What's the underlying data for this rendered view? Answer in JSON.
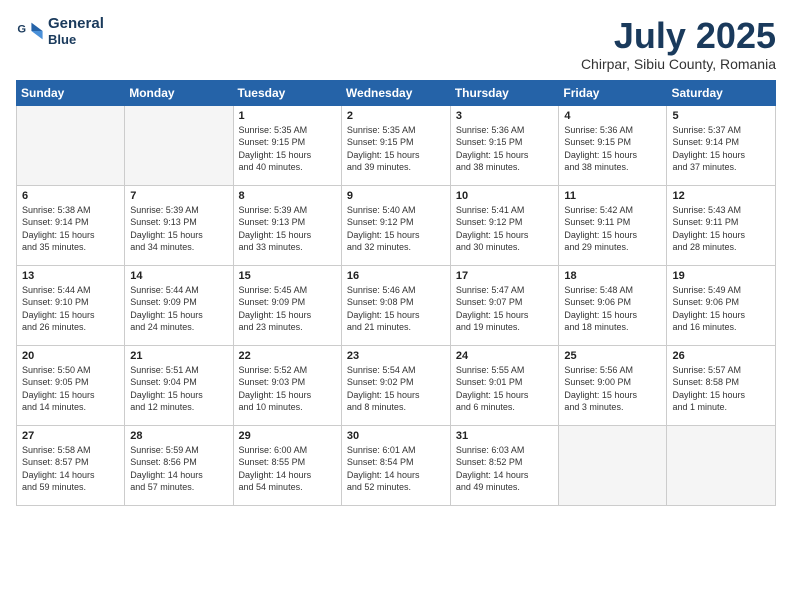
{
  "logo": {
    "line1": "General",
    "line2": "Blue"
  },
  "title": "July 2025",
  "subtitle": "Chirpar, Sibiu County, Romania",
  "weekdays": [
    "Sunday",
    "Monday",
    "Tuesday",
    "Wednesday",
    "Thursday",
    "Friday",
    "Saturday"
  ],
  "weeks": [
    [
      {
        "day": "",
        "info": ""
      },
      {
        "day": "",
        "info": ""
      },
      {
        "day": "1",
        "info": "Sunrise: 5:35 AM\nSunset: 9:15 PM\nDaylight: 15 hours\nand 40 minutes."
      },
      {
        "day": "2",
        "info": "Sunrise: 5:35 AM\nSunset: 9:15 PM\nDaylight: 15 hours\nand 39 minutes."
      },
      {
        "day": "3",
        "info": "Sunrise: 5:36 AM\nSunset: 9:15 PM\nDaylight: 15 hours\nand 38 minutes."
      },
      {
        "day": "4",
        "info": "Sunrise: 5:36 AM\nSunset: 9:15 PM\nDaylight: 15 hours\nand 38 minutes."
      },
      {
        "day": "5",
        "info": "Sunrise: 5:37 AM\nSunset: 9:14 PM\nDaylight: 15 hours\nand 37 minutes."
      }
    ],
    [
      {
        "day": "6",
        "info": "Sunrise: 5:38 AM\nSunset: 9:14 PM\nDaylight: 15 hours\nand 35 minutes."
      },
      {
        "day": "7",
        "info": "Sunrise: 5:39 AM\nSunset: 9:13 PM\nDaylight: 15 hours\nand 34 minutes."
      },
      {
        "day": "8",
        "info": "Sunrise: 5:39 AM\nSunset: 9:13 PM\nDaylight: 15 hours\nand 33 minutes."
      },
      {
        "day": "9",
        "info": "Sunrise: 5:40 AM\nSunset: 9:12 PM\nDaylight: 15 hours\nand 32 minutes."
      },
      {
        "day": "10",
        "info": "Sunrise: 5:41 AM\nSunset: 9:12 PM\nDaylight: 15 hours\nand 30 minutes."
      },
      {
        "day": "11",
        "info": "Sunrise: 5:42 AM\nSunset: 9:11 PM\nDaylight: 15 hours\nand 29 minutes."
      },
      {
        "day": "12",
        "info": "Sunrise: 5:43 AM\nSunset: 9:11 PM\nDaylight: 15 hours\nand 28 minutes."
      }
    ],
    [
      {
        "day": "13",
        "info": "Sunrise: 5:44 AM\nSunset: 9:10 PM\nDaylight: 15 hours\nand 26 minutes."
      },
      {
        "day": "14",
        "info": "Sunrise: 5:44 AM\nSunset: 9:09 PM\nDaylight: 15 hours\nand 24 minutes."
      },
      {
        "day": "15",
        "info": "Sunrise: 5:45 AM\nSunset: 9:09 PM\nDaylight: 15 hours\nand 23 minutes."
      },
      {
        "day": "16",
        "info": "Sunrise: 5:46 AM\nSunset: 9:08 PM\nDaylight: 15 hours\nand 21 minutes."
      },
      {
        "day": "17",
        "info": "Sunrise: 5:47 AM\nSunset: 9:07 PM\nDaylight: 15 hours\nand 19 minutes."
      },
      {
        "day": "18",
        "info": "Sunrise: 5:48 AM\nSunset: 9:06 PM\nDaylight: 15 hours\nand 18 minutes."
      },
      {
        "day": "19",
        "info": "Sunrise: 5:49 AM\nSunset: 9:06 PM\nDaylight: 15 hours\nand 16 minutes."
      }
    ],
    [
      {
        "day": "20",
        "info": "Sunrise: 5:50 AM\nSunset: 9:05 PM\nDaylight: 15 hours\nand 14 minutes."
      },
      {
        "day": "21",
        "info": "Sunrise: 5:51 AM\nSunset: 9:04 PM\nDaylight: 15 hours\nand 12 minutes."
      },
      {
        "day": "22",
        "info": "Sunrise: 5:52 AM\nSunset: 9:03 PM\nDaylight: 15 hours\nand 10 minutes."
      },
      {
        "day": "23",
        "info": "Sunrise: 5:54 AM\nSunset: 9:02 PM\nDaylight: 15 hours\nand 8 minutes."
      },
      {
        "day": "24",
        "info": "Sunrise: 5:55 AM\nSunset: 9:01 PM\nDaylight: 15 hours\nand 6 minutes."
      },
      {
        "day": "25",
        "info": "Sunrise: 5:56 AM\nSunset: 9:00 PM\nDaylight: 15 hours\nand 3 minutes."
      },
      {
        "day": "26",
        "info": "Sunrise: 5:57 AM\nSunset: 8:58 PM\nDaylight: 15 hours\nand 1 minute."
      }
    ],
    [
      {
        "day": "27",
        "info": "Sunrise: 5:58 AM\nSunset: 8:57 PM\nDaylight: 14 hours\nand 59 minutes."
      },
      {
        "day": "28",
        "info": "Sunrise: 5:59 AM\nSunset: 8:56 PM\nDaylight: 14 hours\nand 57 minutes."
      },
      {
        "day": "29",
        "info": "Sunrise: 6:00 AM\nSunset: 8:55 PM\nDaylight: 14 hours\nand 54 minutes."
      },
      {
        "day": "30",
        "info": "Sunrise: 6:01 AM\nSunset: 8:54 PM\nDaylight: 14 hours\nand 52 minutes."
      },
      {
        "day": "31",
        "info": "Sunrise: 6:03 AM\nSunset: 8:52 PM\nDaylight: 14 hours\nand 49 minutes."
      },
      {
        "day": "",
        "info": ""
      },
      {
        "day": "",
        "info": ""
      }
    ]
  ]
}
